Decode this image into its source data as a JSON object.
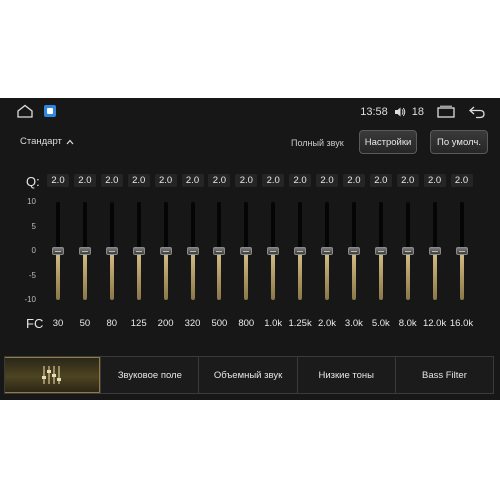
{
  "status_bar": {
    "time": "13:58",
    "volume": "18",
    "icons": [
      "home-icon",
      "app-icon",
      "volume-icon",
      "recent-apps-icon",
      "back-icon"
    ]
  },
  "header": {
    "preset_label": "Стандарт",
    "full_sound_label": "Полный звук",
    "settings_button": "Настройки",
    "default_button": "По умолч."
  },
  "eq": {
    "q_label": "Q:",
    "fc_label": "FC",
    "axis_labels": [
      "10",
      "5",
      "0",
      "-5",
      "-10"
    ],
    "bands": [
      {
        "freq": "30",
        "q": "2.0",
        "gain": 0
      },
      {
        "freq": "50",
        "q": "2.0",
        "gain": 0
      },
      {
        "freq": "80",
        "q": "2.0",
        "gain": 0
      },
      {
        "freq": "125",
        "q": "2.0",
        "gain": 0
      },
      {
        "freq": "200",
        "q": "2.0",
        "gain": 0
      },
      {
        "freq": "320",
        "q": "2.0",
        "gain": 0
      },
      {
        "freq": "500",
        "q": "2.0",
        "gain": 0
      },
      {
        "freq": "800",
        "q": "2.0",
        "gain": 0
      },
      {
        "freq": "1.0k",
        "q": "2.0",
        "gain": 0
      },
      {
        "freq": "1.25k",
        "q": "2.0",
        "gain": 0
      },
      {
        "freq": "2.0k",
        "q": "2.0",
        "gain": 0
      },
      {
        "freq": "3.0k",
        "q": "2.0",
        "gain": 0
      },
      {
        "freq": "5.0k",
        "q": "2.0",
        "gain": 0
      },
      {
        "freq": "8.0k",
        "q": "2.0",
        "gain": 0
      },
      {
        "freq": "12.0k",
        "q": "2.0",
        "gain": 0
      },
      {
        "freq": "16.0k",
        "q": "2.0",
        "gain": 0
      }
    ]
  },
  "tabs": {
    "eq_icon": "equalizer-icon",
    "sound_field": "Звуковое поле",
    "surround": "Объемный звук",
    "bass": "Низкие тоны",
    "bass_filter": "Bass Filter"
  },
  "colors": {
    "accent": "#c9b27a",
    "background": "#171717"
  }
}
